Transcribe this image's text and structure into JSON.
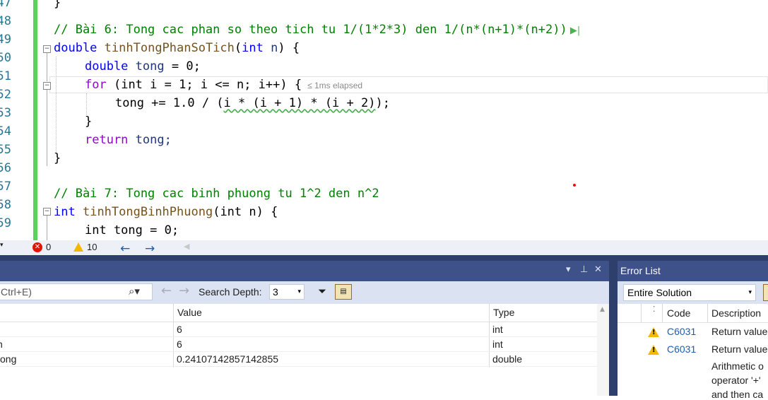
{
  "editor": {
    "line_numbers": [
      "47",
      "48",
      "49",
      "50",
      "51",
      "52",
      "53",
      "54",
      "55",
      "56",
      "57",
      "58",
      "59"
    ],
    "lines": {
      "l47": "}",
      "l48": "// Bài 6: Tong cac phan so theo tich tu 1/(1*2*3) den 1/(n*(n+1)*(n+2))",
      "l49_type": "double",
      "l49_fn": "tinhTongPhanSoTich",
      "l49_rest1": "(",
      "l49_ptype": "int",
      "l49_param": "n",
      "l49_rest2": ") {",
      "l50": "double tong = 0;",
      "l51_kw": "for",
      "l51_rest": "(int i = 1; i <= n; i++) {",
      "l51_hint": "≤ 1ms elapsed",
      "l52_a": "tong += 1.0 / (",
      "l52_b": "i * (i + 1) * (i + 2)",
      "l52_c": ");",
      "l53": "}",
      "l54_kw": "return",
      "l54_rest": "tong;",
      "l55": "}",
      "l57": "// Bài 7: Tong cac binh phuong tu 1^2 den n^2",
      "l58_type": "int",
      "l58_fn": "tinhTongBinhPhuong",
      "l58_rest": "(int n) {",
      "l59": "int tong = 0;"
    }
  },
  "status": {
    "errors": "0",
    "warnings": "10"
  },
  "autos": {
    "search_placeholder": "Ctrl+E)",
    "search_depth_label": "Search Depth:",
    "search_depth_value": "3",
    "columns": {
      "name": "",
      "value": "Value",
      "type": "Type"
    },
    "rows": [
      {
        "name": "",
        "value": "6",
        "type": "int"
      },
      {
        "name": "n",
        "value": "6",
        "type": "int"
      },
      {
        "name": "ong",
        "value": "0.24107142857142855",
        "type": "double"
      }
    ]
  },
  "error_list": {
    "title": "Error List",
    "scope": "Entire Solution",
    "columns": {
      "code": "Code",
      "description": "Description"
    },
    "rows": [
      {
        "code": "C6031",
        "description": "Return value"
      },
      {
        "code": "C6031",
        "description": "Return value"
      },
      {
        "code": "",
        "description": "Arithmetic o"
      },
      {
        "code": "",
        "description": "operator '+'"
      },
      {
        "code": "",
        "description": "and then ca"
      }
    ]
  }
}
